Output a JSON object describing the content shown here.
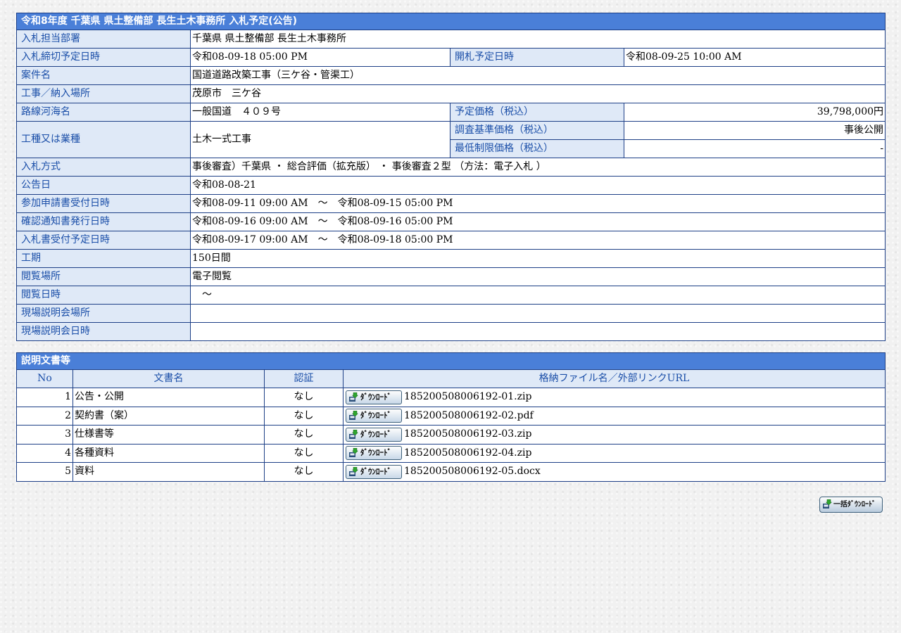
{
  "notice": {
    "title": "令和8年度 千葉県 県土整備部 長生土木事務所 入札予定(公告)",
    "rows": {
      "dept_label": "入札担当部署",
      "dept_value": "千葉県 県土整備部 長生土木事務所",
      "deadline_label": "入札締切予定日時",
      "deadline_value": "令和08-09-18 05:00 PM",
      "opening_label": "開札予定日時",
      "opening_value": "令和08-09-25 10:00 AM",
      "case_label": "案件名",
      "case_value": "国道道路改築工事（三ケ谷・管渠工）",
      "place_label": "工事／納入場所",
      "place_value": "茂原市　三ケ谷",
      "route_label": "路線河海名",
      "route_value": "一般国道　４０９号",
      "planned_price_label": "予定価格（税込）",
      "planned_price_value": "39,798,000円",
      "type_label": "工種又は業種",
      "type_value": "土木一式工事",
      "survey_price_label": "調査基準価格（税込）",
      "survey_price_value": "事後公開",
      "min_price_label": "最低制限価格（税込）",
      "min_price_value": "-",
      "method_label": "入札方式",
      "method_value": "事後審査）千葉県 ・ 総合評価（拡充版） ・ 事後審査２型 （方法：電子入札 ）",
      "announce_label": "公告日",
      "announce_value": "令和08-08-21",
      "apply_label": "参加申請書受付日時",
      "apply_value": "令和08-09-11 09:00 AM　～　令和08-09-15 05:00 PM",
      "confirm_label": "確認通知書発行日時",
      "confirm_value": "令和08-09-16 09:00 AM　～　令和08-09-16 05:00 PM",
      "bid_accept_label": "入札書受付予定日時",
      "bid_accept_value": "令和08-09-17 09:00 AM　～　令和08-09-18 05:00 PM",
      "period_label": "工期",
      "period_value": "150日間",
      "view_place_label": "閲覧場所",
      "view_place_value": "電子閲覧",
      "view_time_label": "閲覧日時",
      "view_time_value": "　～",
      "site_place_label": "現場説明会場所",
      "site_place_value": "",
      "site_time_label": "現場説明会日時",
      "site_time_value": ""
    }
  },
  "docs": {
    "title": "説明文書等",
    "headers": [
      "No",
      "文書名",
      "認証",
      "格納ファイル名／外部リンクURL"
    ],
    "download_label": "ﾀﾞｳﾝﾛｰﾄﾞ",
    "items": [
      {
        "no": "1",
        "name": "公告・公開",
        "auth": "なし",
        "file": "185200508006192-01.zip"
      },
      {
        "no": "2",
        "name": "契約書（案）",
        "auth": "なし",
        "file": "185200508006192-02.pdf"
      },
      {
        "no": "3",
        "name": "仕様書等",
        "auth": "なし",
        "file": "185200508006192-03.zip"
      },
      {
        "no": "4",
        "name": "各種資料",
        "auth": "なし",
        "file": "185200508006192-04.zip"
      },
      {
        "no": "5",
        "name": "資料",
        "auth": "なし",
        "file": "185200508006192-05.docx"
      }
    ]
  },
  "bulk_download": {
    "label": "一括ﾀﾞｳﾝﾛｰﾄﾞ",
    "icon": "download-icon"
  },
  "colors": {
    "title_bg": "#4a7fd8",
    "label_bg": "#dfe9f7",
    "label_text": "#1a4ea8",
    "border": "#1d3f86"
  }
}
